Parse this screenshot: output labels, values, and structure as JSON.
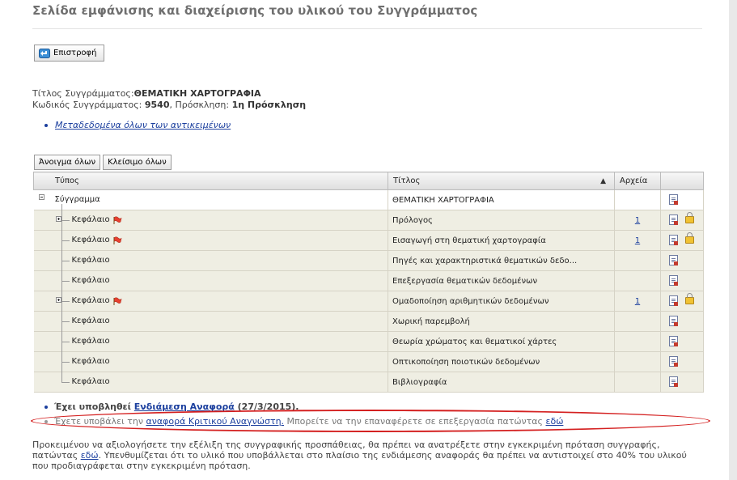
{
  "page": {
    "title": "Σελίδα εμφάνισης και διαχείρισης του υλικού του Συγγράμματος",
    "back_label": "Επιστροφή",
    "book_title_label": "Τίτλος Συγγράμματος:",
    "book_title_value": "ΘΕΜΑΤΙΚΗ ΧΑΡΤΟΓΡΑΦΙΑ",
    "book_code_label": "Κωδικός Συγγράμματος:",
    "book_code_value": "9540",
    "invitation_label": ", Πρόσκληση:",
    "invitation_value": "1η Πρόσκληση",
    "metadata_link": "Μεταδεδομένα όλων των αντικειμένων"
  },
  "toolbar": {
    "expand_all": "Άνοιγμα όλων",
    "collapse_all": "Κλείσιμο όλων"
  },
  "table": {
    "headers": {
      "type": "Τύπος",
      "title": "Τίτλος",
      "files": "Αρχεία",
      "sort_icon": "▲"
    },
    "rows": [
      {
        "type": "Σύγγραμμα",
        "title": "ΘΕΜΑΤΙΚΗ ΧΑΡΤΟΓΡΑΦΙΑ",
        "files": "",
        "flag": false,
        "lock": false,
        "expander": "minus"
      },
      {
        "type": "Κεφάλαιο",
        "title": "Πρόλογος",
        "files": "1",
        "flag": true,
        "lock": true,
        "expander": "plus"
      },
      {
        "type": "Κεφάλαιο",
        "title": "Εισαγωγή στη θεματική χαρτογραφία",
        "files": "1",
        "flag": true,
        "lock": true,
        "expander": ""
      },
      {
        "type": "Κεφάλαιο",
        "title": "Πηγές και χαρακτηριστικά θεματικών δεδο...",
        "files": "",
        "flag": false,
        "lock": false,
        "expander": ""
      },
      {
        "type": "Κεφάλαιο",
        "title": "Επεξεργασία θεματικών δεδομένων",
        "files": "",
        "flag": false,
        "lock": false,
        "expander": ""
      },
      {
        "type": "Κεφάλαιο",
        "title": "Ομαδοποίηση αριθμητικών δεδομένων",
        "files": "1",
        "flag": true,
        "lock": true,
        "expander": "plus"
      },
      {
        "type": "Κεφάλαιο",
        "title": "Χωρική παρεμβολή",
        "files": "",
        "flag": false,
        "lock": false,
        "expander": ""
      },
      {
        "type": "Κεφάλαιο",
        "title": "Θεωρία χρώματος και θεματικοί χάρτες",
        "files": "",
        "flag": false,
        "lock": false,
        "expander": ""
      },
      {
        "type": "Κεφάλαιο",
        "title": "Οπτικοποίηση ποιοτικών δεδομένων",
        "files": "",
        "flag": false,
        "lock": false,
        "expander": ""
      },
      {
        "type": "Κεφάλαιο",
        "title": "Βιβλιογραφία",
        "files": "",
        "flag": false,
        "lock": false,
        "expander": ""
      }
    ]
  },
  "notes": {
    "n1_prefix": "Έχει υποβληθεί ",
    "n1_link": "Ενδιάμεση Αναφορά",
    "n1_suffix": " (27/3/2015).",
    "n2_prefix": "Έχετε υποβάλει την ",
    "n2_link": "αναφορά Κριτικού Αναγνώστη.",
    "n2_middle": " Μπορείτε να την επαναφέρετε σε επεξεργασία πατώντας ",
    "n2_link2": "εδώ"
  },
  "footer": {
    "p1": "Προκειμένου να αξιολογήσετε την εξέλιξη της συγγραφικής προσπάθειας, θα πρέπει να ανατρέξετε στην εγκεκριμένη πρόταση συγγραφής, πατώντας",
    "link": "εδώ",
    "p2": ". Υπενθυμίζεται ότι το υλικό που υποβάλλεται στο πλαίσιο της ενδιάμεσης αναφοράς θα πρέπει να αντιστοιχεί στο 40% του υλικού που προδιαγράφεται στην εγκεκριμένη πρόταση."
  }
}
